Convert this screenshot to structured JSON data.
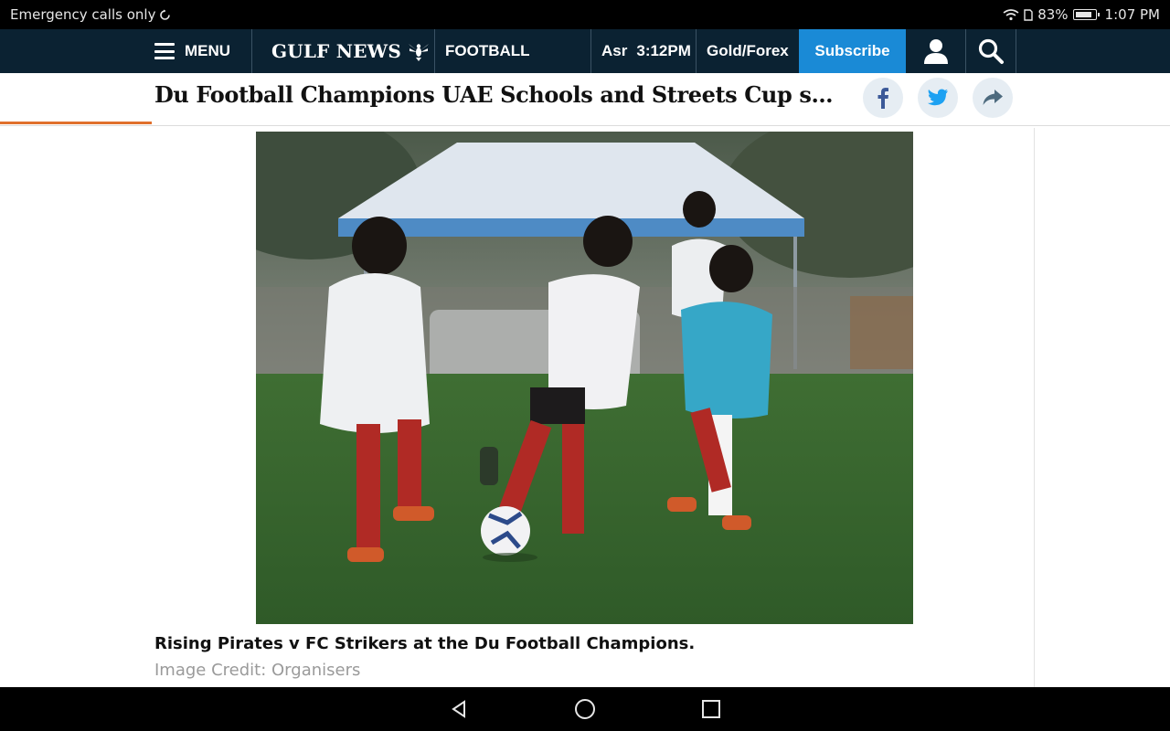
{
  "status_bar": {
    "left_text": "Emergency calls only",
    "battery_percent": "83%",
    "time": "1:07 PM"
  },
  "nav": {
    "menu_label": "MENU",
    "logo_text": "GULF NEWS",
    "section_label": "FOOTBALL",
    "prayer_name": "Asr",
    "prayer_time": "3:12PM",
    "gold_forex_label": "Gold/Forex",
    "subscribe_label": "Subscribe",
    "icons": [
      "menu-icon",
      "falcon-icon",
      "user-icon",
      "search-icon"
    ]
  },
  "article": {
    "headline": "Du Football Champions UAE Schools and Streets Cup season ki…",
    "share_icons": [
      "facebook-icon",
      "twitter-icon",
      "share-icon"
    ],
    "caption": "Rising Pirates v FC Strikers at the Du Football Champions.",
    "credit": "Image Credit: Organisers"
  },
  "android_nav": {
    "icons": [
      "back-icon",
      "home-icon",
      "recents-icon"
    ]
  },
  "colors": {
    "nav_background": "#0b2232",
    "subscribe_blue": "#1a8ad6",
    "accent_orange": "#e0702c",
    "share_button_bg": "#e6edf3",
    "facebook_blue": "#3b5998",
    "twitter_blue": "#1da1f2"
  }
}
